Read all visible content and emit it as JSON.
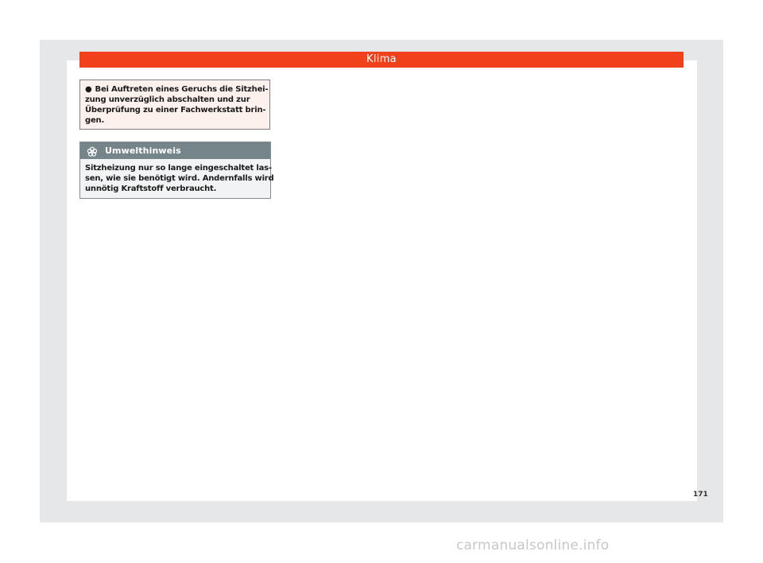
{
  "header": {
    "title": "Klima"
  },
  "warning": {
    "bullet": "●",
    "lines": [
      "Bei Auftreten eines Geruchs die Sitzhei-",
      "zung unverzüglich abschalten und zur",
      "Überprüfung zu einer Fachwerkstatt brin-",
      "gen."
    ]
  },
  "environment_note": {
    "icon": "flower-icon",
    "title": "Umwelthinweis",
    "lines": [
      "Sitzheizung nur so lange eingeschaltet las-",
      "sen, wie sie benötigt wird. Andernfalls wird",
      "unnötig Kraftstoff verbraucht."
    ]
  },
  "footer": {
    "page_number": "171",
    "watermark": "carmanualsonline.info"
  },
  "colors": {
    "accent": "#f0401c",
    "note_header": "#76858a",
    "frame": "#e6e7e8"
  }
}
